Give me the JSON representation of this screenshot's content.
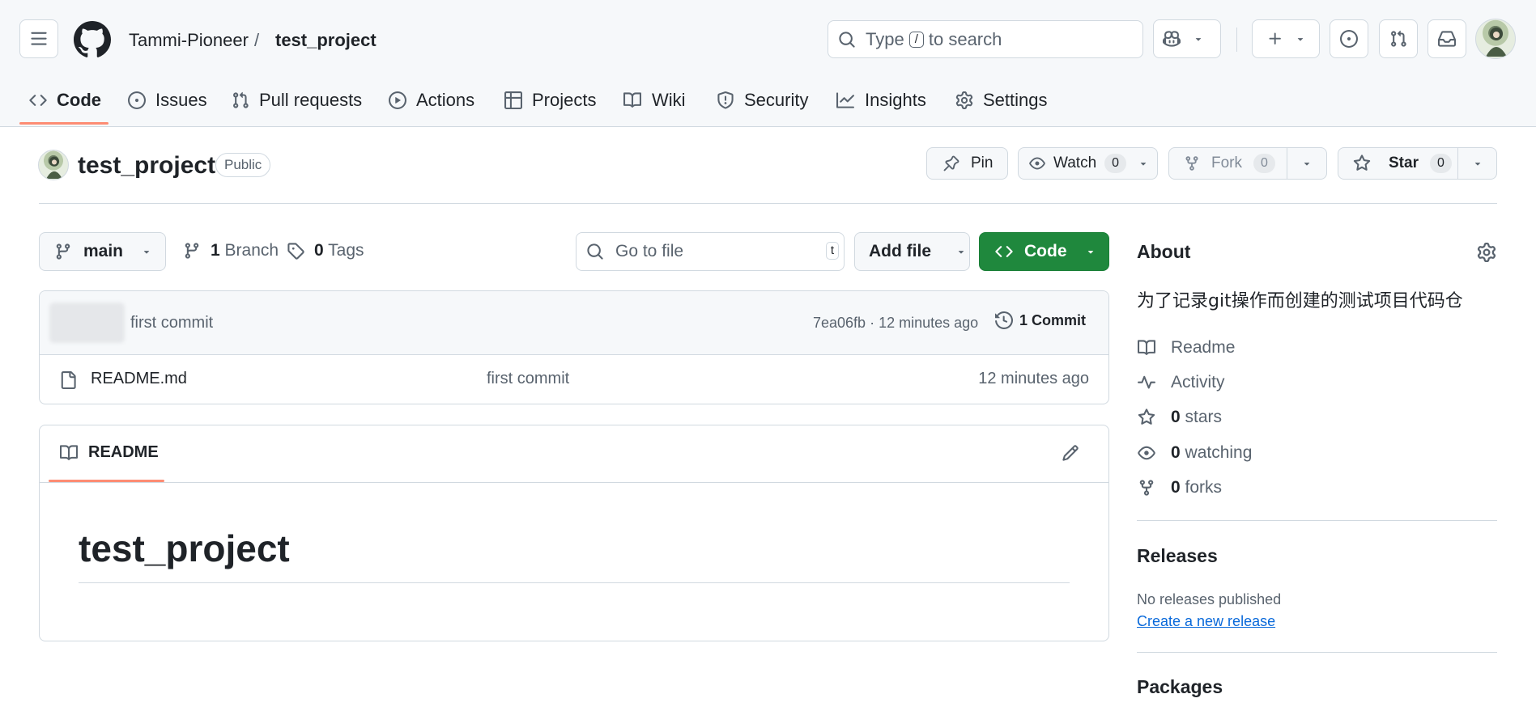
{
  "header": {
    "owner": "Tammi-Pioneer",
    "separator": "/",
    "repo": "test_project",
    "search": {
      "prefix": "Type",
      "key": "/",
      "suffix": "to search"
    }
  },
  "tabs": [
    {
      "label": "Code",
      "icon": "code-icon",
      "active": true
    },
    {
      "label": "Issues",
      "icon": "issue-opened-icon"
    },
    {
      "label": "Pull requests",
      "icon": "git-pull-request-icon"
    },
    {
      "label": "Actions",
      "icon": "play-icon"
    },
    {
      "label": "Projects",
      "icon": "table-icon"
    },
    {
      "label": "Wiki",
      "icon": "book-icon"
    },
    {
      "label": "Security",
      "icon": "shield-icon"
    },
    {
      "label": "Insights",
      "icon": "graph-icon"
    },
    {
      "label": "Settings",
      "icon": "gear-icon"
    }
  ],
  "repo_header": {
    "name": "test_project",
    "visibility": "Public",
    "pin_label": "Pin",
    "watch_label": "Watch",
    "watch_count": "0",
    "fork_label": "Fork",
    "fork_count": "0",
    "star_label": "Star",
    "star_count": "0"
  },
  "toolbar": {
    "branch": "main",
    "branch_count": "1",
    "branch_label": "Branch",
    "tag_count": "0",
    "tag_label": "Tags",
    "goto_placeholder": "Go to file",
    "goto_key": "t",
    "add_file_label": "Add file",
    "code_label": "Code"
  },
  "latest_commit": {
    "message": "first commit",
    "hash": "7ea06fb",
    "time": "12 minutes ago",
    "commit_count": "1 Commit"
  },
  "files": [
    {
      "name": "README.md",
      "message": "first commit",
      "time": "12 minutes ago"
    }
  ],
  "readme": {
    "tab_label": "README",
    "heading": "test_project"
  },
  "about": {
    "title": "About",
    "description": "为了记录git操作而创建的测试项目代码仓",
    "readme": "Readme",
    "activity": "Activity",
    "stars_count": "0",
    "stars_label": "stars",
    "watching_count": "0",
    "watching_label": "watching",
    "forks_count": "0",
    "forks_label": "forks",
    "releases_title": "Releases",
    "no_releases": "No releases published",
    "create_release": "Create a new release",
    "packages_title": "Packages"
  },
  "colors": {
    "accent_underline": "#fd8c73",
    "code_button": "#1f883d",
    "link": "#0969da",
    "border": "#d1d9e0",
    "muted": "#59636e"
  }
}
